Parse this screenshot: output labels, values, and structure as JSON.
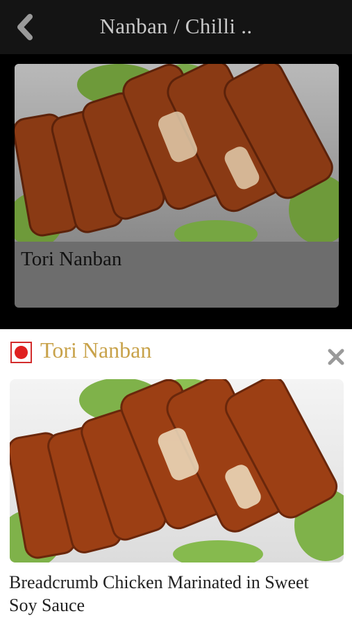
{
  "header": {
    "title": "Nanban / Chilli ..",
    "back_icon": "chevron-left-icon"
  },
  "card": {
    "title": "Tori Nanban",
    "image": "tori-nanban-photo"
  },
  "popup": {
    "title": "Tori Nanban",
    "flag_icon": "japan-flag-icon",
    "close_icon": "close-icon",
    "image": "tori-nanban-photo",
    "description": "Breadcrumb Chicken Marinated in Sweet Soy Sauce"
  },
  "colors": {
    "header_bg": "#141414",
    "card_bg": "#6d6d6d",
    "popup_title": "#c8a24a",
    "flag_red": "#e02020"
  }
}
